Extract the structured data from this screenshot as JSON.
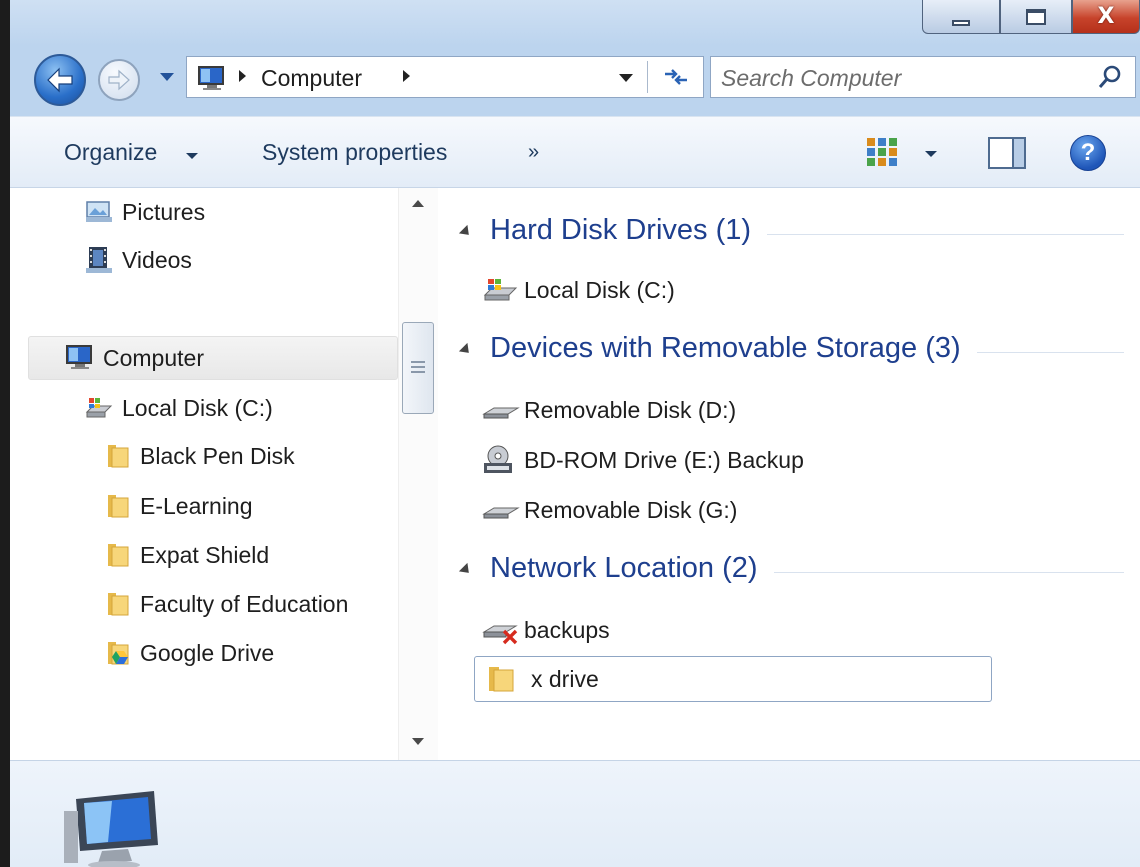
{
  "window": {
    "caption_buttons": {
      "minimize": "minimize-icon",
      "maximize": "maximize-icon",
      "close": "close-icon",
      "close_glyph": "X"
    }
  },
  "address": {
    "breadcrumb": [
      "Computer"
    ],
    "search_placeholder": "Search Computer"
  },
  "toolbar": {
    "organize_label": "Organize",
    "system_properties_label": "System properties",
    "more_label": "»",
    "help_label": "?"
  },
  "nav": {
    "items": [
      {
        "label": "Pictures",
        "icon": "pictures-library-icon"
      },
      {
        "label": "Videos",
        "icon": "videos-library-icon"
      },
      {
        "label": "Computer",
        "icon": "computer-icon",
        "selected": true
      },
      {
        "label": "Local Disk (C:)",
        "icon": "local-disk-icon"
      },
      {
        "label": "Black Pen Disk",
        "icon": "folder-icon"
      },
      {
        "label": "E-Learning",
        "icon": "folder-icon"
      },
      {
        "label": "Expat Shield",
        "icon": "folder-icon"
      },
      {
        "label": "Faculty of Education",
        "icon": "folder-icon"
      },
      {
        "label": "Google Drive",
        "icon": "google-drive-folder-icon"
      }
    ]
  },
  "content": {
    "groups": [
      {
        "title": "Hard Disk Drives (1)",
        "items": [
          {
            "label": "Local Disk (C:)",
            "icon": "local-disk-icon"
          }
        ]
      },
      {
        "title": "Devices with Removable Storage (3)",
        "items": [
          {
            "label": "Removable Disk (D:)",
            "icon": "removable-disk-icon"
          },
          {
            "label": "BD-ROM Drive (E:) Backup",
            "icon": "bd-rom-drive-icon"
          },
          {
            "label": "Removable Disk (G:)",
            "icon": "removable-disk-icon"
          }
        ]
      },
      {
        "title": "Network Location (2)",
        "items": [
          {
            "label": "backups",
            "icon": "disconnected-network-drive-icon"
          },
          {
            "label": "x drive",
            "icon": "folder-icon",
            "selected": true
          }
        ]
      }
    ]
  },
  "colors": {
    "group_title": "#1e3f8e",
    "titlebar": "#bcd4ee",
    "close_button": "#c7432b"
  }
}
